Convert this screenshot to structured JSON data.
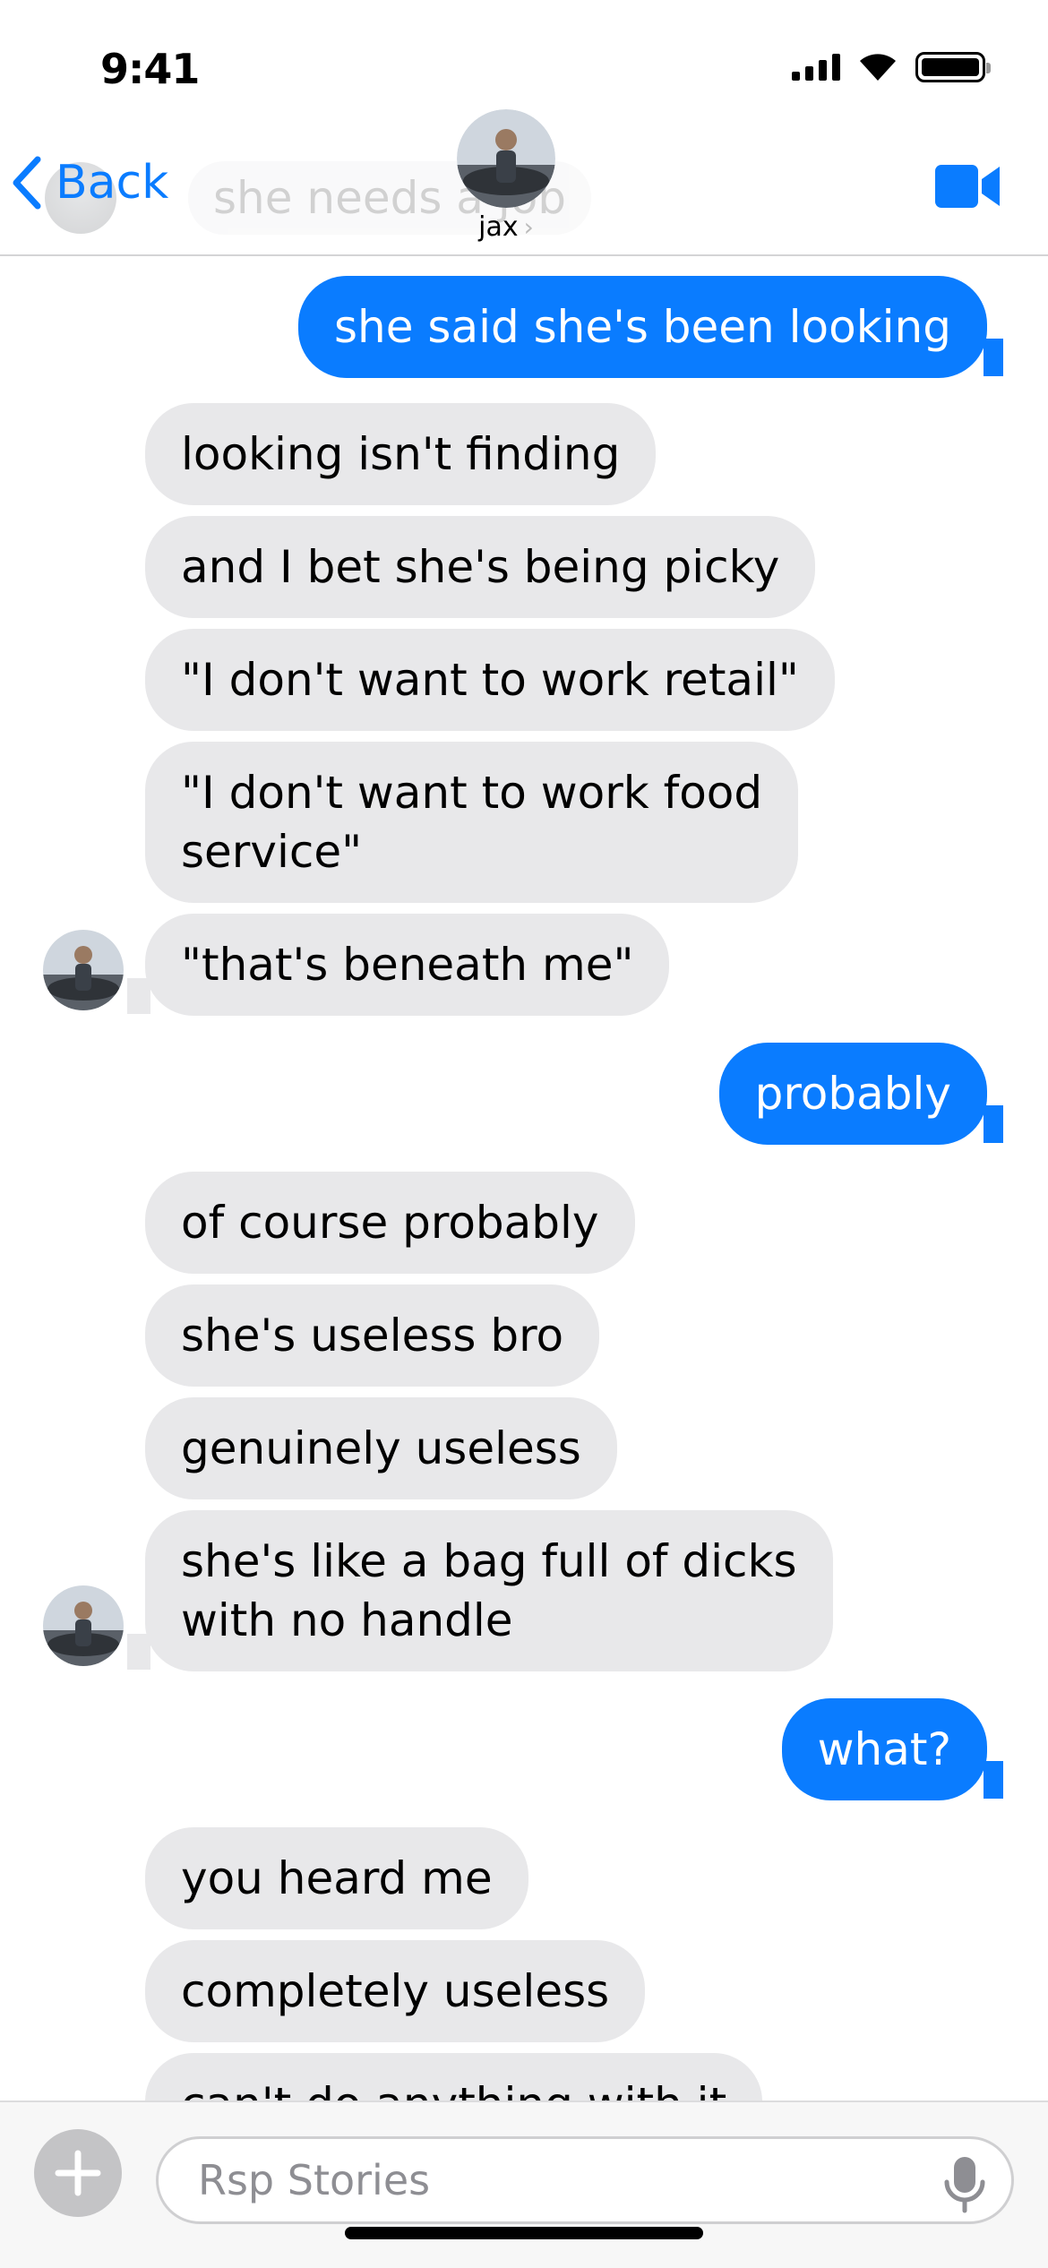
{
  "status_bar": {
    "time": "9:41"
  },
  "header": {
    "back_label": "Back",
    "contact_name": "jax",
    "preview_text": "she needs a job"
  },
  "messages": [
    {
      "text": "she said she's been looking",
      "direction": "sent"
    },
    {
      "text": "looking isn't finding",
      "direction": "received"
    },
    {
      "text": "and I bet she's being picky",
      "direction": "received"
    },
    {
      "text": "\"I don't want to work retail\"",
      "direction": "received"
    },
    {
      "text_line1": "\"I don't want to work food",
      "text_line2": "service\"",
      "direction": "received"
    },
    {
      "text": "\"that's beneath me\"",
      "direction": "received"
    },
    {
      "text": "probably",
      "direction": "sent"
    },
    {
      "text": "of course probably",
      "direction": "received"
    },
    {
      "text": "she's useless bro",
      "direction": "received"
    },
    {
      "text": "genuinely useless",
      "direction": "received"
    },
    {
      "text_line1": "she's like a bag full of dicks",
      "text_line2": "with no handle",
      "direction": "received"
    },
    {
      "text": "what?",
      "direction": "sent"
    },
    {
      "text": "you heard me",
      "direction": "received"
    },
    {
      "text": "completely useless",
      "direction": "received"
    },
    {
      "text": "can't do anything with it",
      "direction": "received"
    }
  ],
  "input_bar": {
    "placeholder": "Rsp Stories"
  },
  "colors": {
    "accent": "#0a7cff",
    "received_bubble": "#e8e8ea",
    "sent_text": "#ffffff"
  },
  "icons": [
    "signal-icon",
    "wifi-icon",
    "battery-icon",
    "chevron-left-icon",
    "video-camera-icon",
    "plus-icon",
    "microphone-icon"
  ]
}
